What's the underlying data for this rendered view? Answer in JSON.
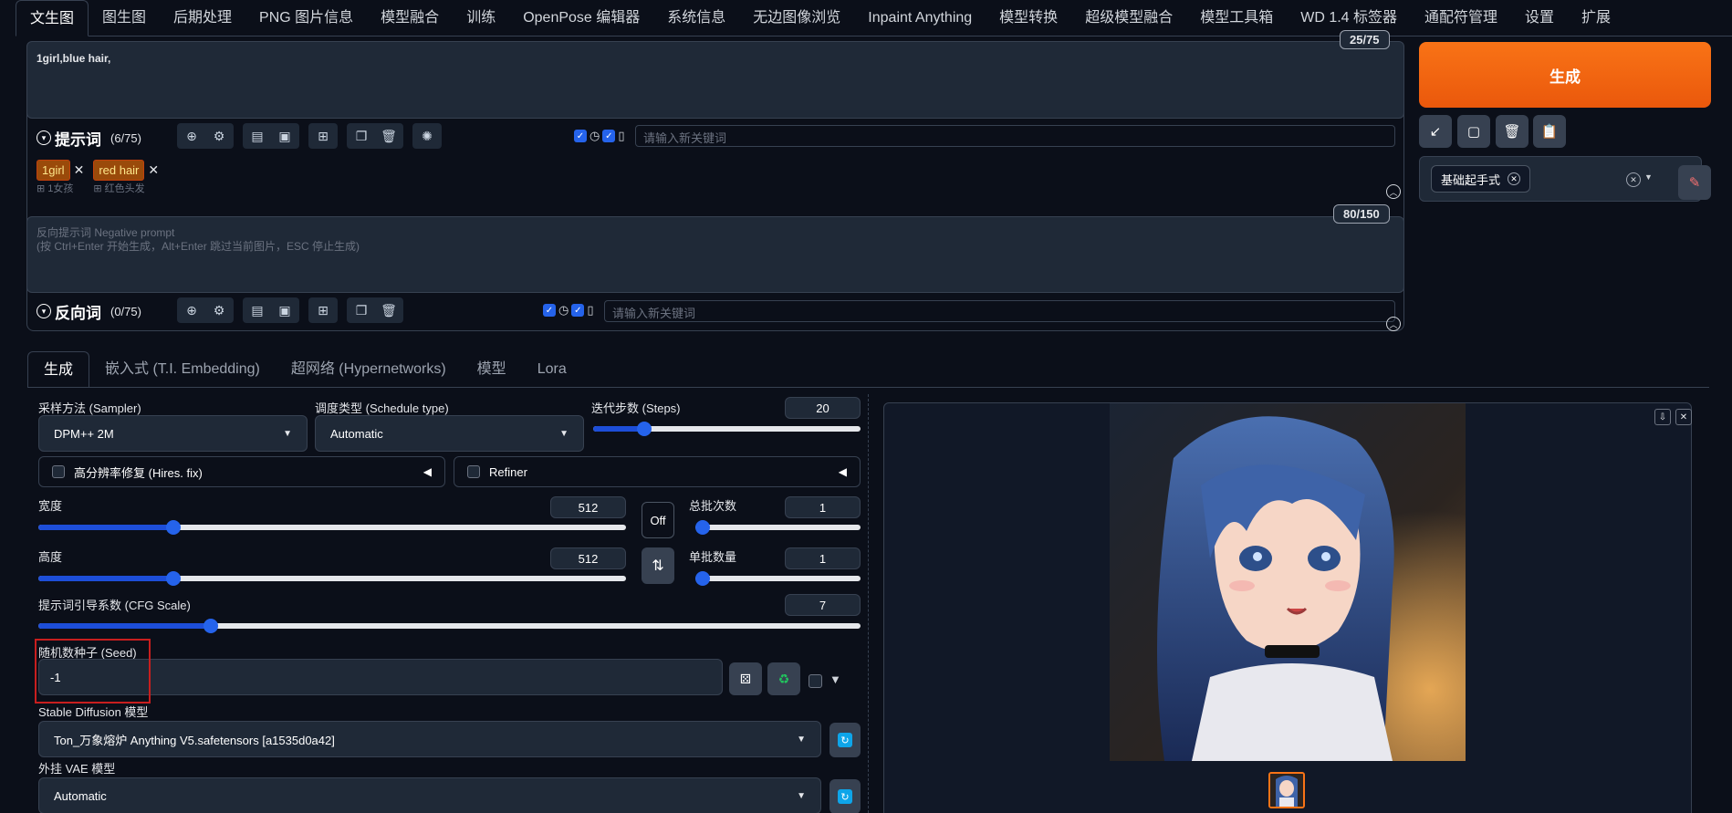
{
  "top_tabs": [
    "文生图",
    "图生图",
    "后期处理",
    "PNG 图片信息",
    "模型融合",
    "训练",
    "OpenPose 编辑器",
    "系统信息",
    "无边图像浏览",
    "Inpaint Anything",
    "模型转换",
    "超级模型融合",
    "模型工具箱",
    "WD 1.4 标签器",
    "通配符管理",
    "设置",
    "扩展"
  ],
  "prompt": {
    "text": "1girl,blue hair,",
    "counter": "25/75",
    "title": "提示词",
    "count": "(6/75)",
    "keyword_placeholder": "请输入新关键词",
    "tags": [
      {
        "label": "1girl",
        "sub": "1女孩"
      },
      {
        "label": "red hair",
        "sub": "红色头发"
      }
    ]
  },
  "negative": {
    "placeholder_line1": "反向提示词 Negative prompt",
    "placeholder_line2": "(按 Ctrl+Enter 开始生成，Alt+Enter 跳过当前图片，ESC 停止生成)",
    "counter": "80/150",
    "title": "反向词",
    "count": "(0/75)",
    "keyword_placeholder": "请输入新关键词"
  },
  "right": {
    "generate_label": "生成",
    "style_chip": "基础起手式"
  },
  "sub_tabs": [
    "生成",
    "嵌入式 (T.I. Embedding)",
    "超网络 (Hypernetworks)",
    "模型",
    "Lora"
  ],
  "params": {
    "sampler_label": "采样方法 (Sampler)",
    "sampler_value": "DPM++ 2M",
    "schedule_label": "调度类型 (Schedule type)",
    "schedule_value": "Automatic",
    "steps_label": "迭代步数 (Steps)",
    "steps_value": "20",
    "steps_fraction": 0.19,
    "hires_label": "高分辨率修复 (Hires. fix)",
    "refiner_label": "Refiner",
    "width_label": "宽度",
    "width_value": "512",
    "width_fraction": 0.23,
    "height_label": "高度",
    "height_value": "512",
    "height_fraction": 0.23,
    "off_label": "Off",
    "batch_count_label": "总批次数",
    "batch_count_value": "1",
    "batch_size_label": "单批数量",
    "batch_size_value": "1",
    "cfg_label": "提示词引导系数 (CFG Scale)",
    "cfg_value": "7",
    "cfg_fraction": 0.21,
    "seed_label": "随机数种子 (Seed)",
    "seed_value": "-1",
    "model_label": "Stable Diffusion 模型",
    "model_value": "Ton_万象熔炉 Anything V5.safetensors [a1535d0a42]",
    "vae_label": "外挂 VAE 模型",
    "vae_value": "Automatic"
  },
  "colors": {
    "accent": "#2563eb",
    "generate": "#f97316",
    "background": "#0b0f19"
  }
}
